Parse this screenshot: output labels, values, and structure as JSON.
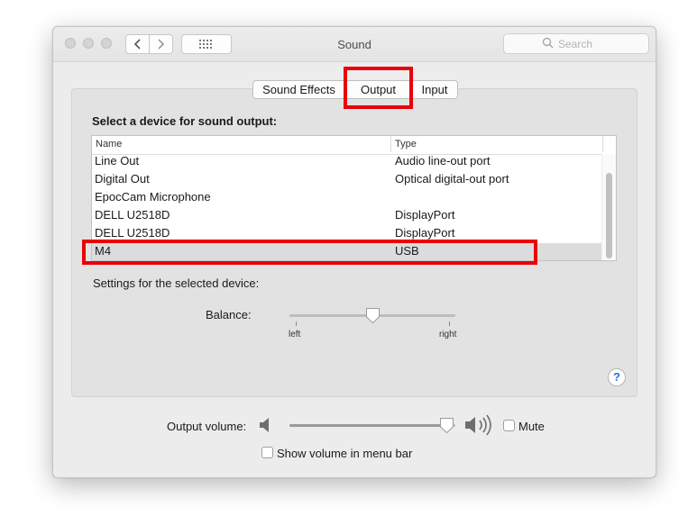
{
  "window": {
    "title": "Sound"
  },
  "search": {
    "placeholder": "Search",
    "icon": "magnifier-icon"
  },
  "toolbar": {
    "back_icon": "chevron-left-icon",
    "forward_icon": "chevron-right-icon",
    "grid_icon": "grid-icon"
  },
  "tabs": [
    {
      "label": "Sound Effects",
      "selected": false
    },
    {
      "label": "Output",
      "selected": true
    },
    {
      "label": "Input",
      "selected": false
    }
  ],
  "device_section": {
    "heading": "Select a device for sound output:",
    "columns": [
      "Name",
      "Type"
    ],
    "rows": [
      {
        "name": "Line Out",
        "type": "Audio line-out port"
      },
      {
        "name": "Digital Out",
        "type": "Optical digital-out port"
      },
      {
        "name": "EpocCam Microphone",
        "type": ""
      },
      {
        "name": "DELL U2518D",
        "type": "DisplayPort"
      },
      {
        "name": "DELL U2518D",
        "type": "DisplayPort"
      },
      {
        "name": "M4",
        "type": "USB",
        "selected": true
      }
    ]
  },
  "settings": {
    "caption": "Settings for the selected device:",
    "balance_label": "Balance:",
    "balance_left": "left",
    "balance_right": "right",
    "balance_value": 0.5
  },
  "help_label": "?",
  "volume": {
    "label": "Output volume:",
    "value": 0.95,
    "mute_label": "Mute",
    "mute_checked": false,
    "low_icon": "speaker-low-icon",
    "high_icon": "speaker-high-icon"
  },
  "menubar_option": {
    "label": "Show volume in menu bar",
    "checked": false
  },
  "colors": {
    "highlight": "#e8000a",
    "selected_row": "#dcdcdc",
    "help": "#2a6fd6"
  }
}
